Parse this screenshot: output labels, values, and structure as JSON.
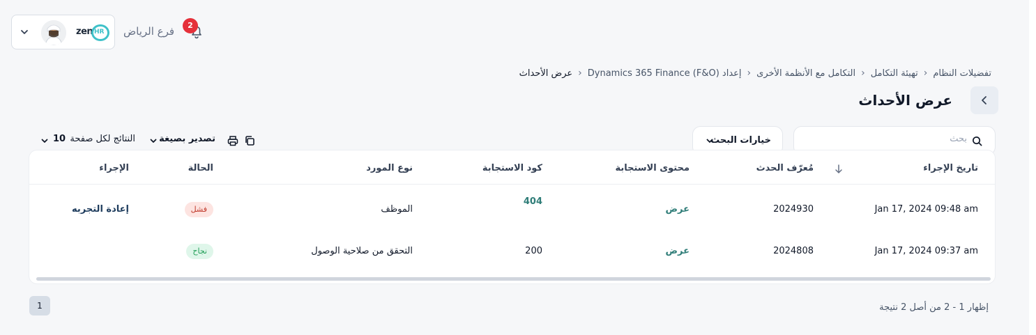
{
  "header": {
    "branch": "فرع الرياض",
    "notification_count": "2",
    "logo_zen": "zen",
    "logo_hr": "HR"
  },
  "breadcrumb": [
    "تفضيلات النظام",
    "تهيئة التكامل",
    "التكامل مع الأنظمة الأخرى",
    "إعداد Dynamics 365 Finance (F&O)",
    "عرض الأحداث"
  ],
  "page": {
    "title": "عرض الأحداث"
  },
  "toolbar": {
    "search_placeholder": "بحث",
    "search_options": "خيارات البحث",
    "export": "تصدير بصيغة",
    "per_page_label": "النتائج لكل صفحة",
    "per_page_value": "10"
  },
  "table": {
    "headers": {
      "date": "تاريخ الإجراء",
      "event_id": "مُعرّف الحدث",
      "response_content": "محتوى الاستجابة",
      "response_code": "كود الاستجابة",
      "provider_type": "نوع المورد",
      "status": "الحالة",
      "action": "الإجراء"
    },
    "rows": [
      {
        "date": "Jan 17, 2024 09:48 am",
        "event_id": "2024930",
        "response_content": "عرض",
        "response_code": "404",
        "provider_type": "الموظف",
        "status": "فشل",
        "action": "إعادة التجربه"
      },
      {
        "date": "Jan 17, 2024 09:37 am",
        "event_id": "2024808",
        "response_content": "عرض",
        "response_code": "200",
        "provider_type": "التحقق من صلاحية الوصول",
        "status": "نجاح",
        "action": ""
      }
    ]
  },
  "pagination": {
    "current_page": "1",
    "summary": "إظهار 1 - 2 من أصل 2 نتيجة"
  },
  "colors": {
    "accent": "#2f7d78",
    "fail_badge": "#fde4e1",
    "success_badge": "#dff6ea",
    "notification": "#e5303a"
  }
}
